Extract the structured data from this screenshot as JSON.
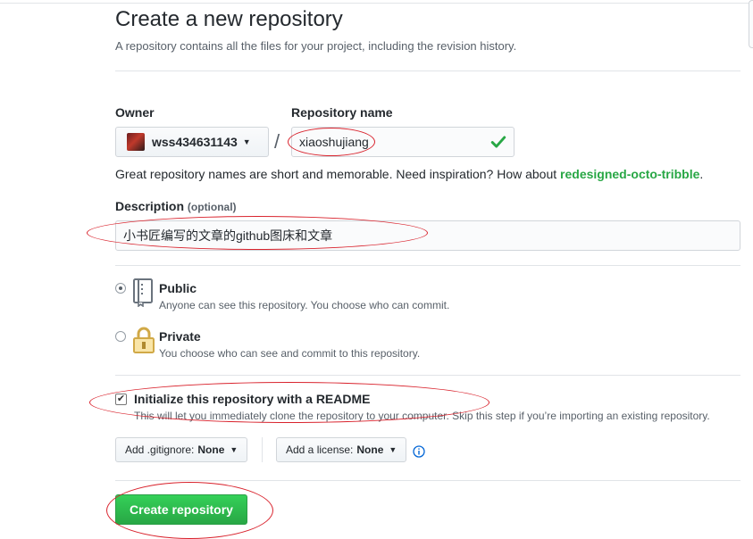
{
  "header": {
    "title": "Create a new repository",
    "subtitle": "A repository contains all the files for your project, including the revision history."
  },
  "owner": {
    "label": "Owner",
    "value": "wss434631143",
    "separator": "/"
  },
  "repository": {
    "label": "Repository name",
    "value": "xiaoshujiang",
    "valid": true
  },
  "hint": {
    "prefix": "Great repository names are short and memorable. Need inspiration? How about ",
    "suggestion": "redesigned-octo-tribble",
    "suffix": "."
  },
  "description": {
    "label": "Description",
    "optional": "(optional)",
    "value": "小书匠编写的文章的github图床和文章"
  },
  "visibility": {
    "selected": "Public",
    "options": [
      {
        "title": "Public",
        "desc": "Anyone can see this repository. You choose who can commit."
      },
      {
        "title": "Private",
        "desc": "You choose who can see and commit to this repository."
      }
    ]
  },
  "readme": {
    "checked": true,
    "title": "Initialize this repository with a README",
    "desc": "This will let you immediately clone the repository to your computer. Skip this step if you’re importing an existing repository."
  },
  "gitignore": {
    "label": "Add .gitignore:",
    "value": "None"
  },
  "license": {
    "label": "Add a license:",
    "value": "None"
  },
  "submit": {
    "label": "Create repository"
  },
  "colors": {
    "accent_green": "#28a745",
    "annotation_red": "#d9232d",
    "info_blue": "#0366d6"
  },
  "icons": [
    "dropdown-caret-icon",
    "check-icon",
    "repo-book-icon",
    "lock-icon",
    "info-icon"
  ]
}
